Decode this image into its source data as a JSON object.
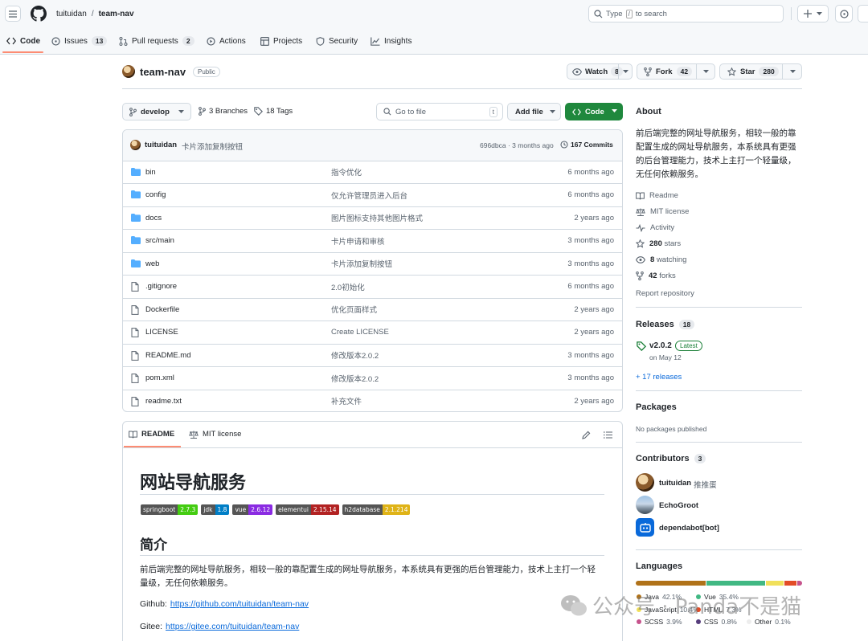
{
  "header": {
    "owner": "tuituidan",
    "sep": "/",
    "repo": "team-nav",
    "search_placeholder_pre": "Type",
    "search_key": "/",
    "search_placeholder_post": "to search"
  },
  "tabs": [
    {
      "label": "Code",
      "count": ""
    },
    {
      "label": "Issues",
      "count": "13"
    },
    {
      "label": "Pull requests",
      "count": "2"
    },
    {
      "label": "Actions",
      "count": ""
    },
    {
      "label": "Projects",
      "count": ""
    },
    {
      "label": "Security",
      "count": ""
    },
    {
      "label": "Insights",
      "count": ""
    }
  ],
  "repo": {
    "name": "team-nav",
    "visibility": "Public",
    "watch_label": "Watch",
    "watch_count": "8",
    "fork_label": "Fork",
    "fork_count": "42",
    "star_label": "Star",
    "star_count": "280"
  },
  "toolbar": {
    "branch": "develop",
    "branches": "3 Branches",
    "tags": "18 Tags",
    "goto_placeholder": "Go to file",
    "goto_key": "t",
    "add_file": "Add file",
    "code": "Code"
  },
  "commit": {
    "author": "tuituidan",
    "message": "卡片添加复制按钮",
    "hash_time": "696dbca · 3 months ago",
    "commits": "167 Commits"
  },
  "files": [
    {
      "type": "dir",
      "name": "bin",
      "msg": "指令优化",
      "time": "6 months ago"
    },
    {
      "type": "dir",
      "name": "config",
      "msg": "仅允许管理员进入后台",
      "time": "6 months ago"
    },
    {
      "type": "dir",
      "name": "docs",
      "msg": "图片图标支持其他图片格式",
      "time": "2 years ago"
    },
    {
      "type": "dir",
      "name": "src/main",
      "msg": "卡片申请和审核",
      "time": "3 months ago"
    },
    {
      "type": "dir",
      "name": "web",
      "msg": "卡片添加复制按钮",
      "time": "3 months ago"
    },
    {
      "type": "file",
      "name": ".gitignore",
      "msg": "2.0初始化",
      "time": "6 months ago"
    },
    {
      "type": "file",
      "name": "Dockerfile",
      "msg": "优化页面样式",
      "time": "2 years ago"
    },
    {
      "type": "file",
      "name": "LICENSE",
      "msg": "Create LICENSE",
      "time": "2 years ago"
    },
    {
      "type": "file",
      "name": "README.md",
      "msg": "修改版本2.0.2",
      "time": "3 months ago"
    },
    {
      "type": "file",
      "name": "pom.xml",
      "msg": "修改版本2.0.2",
      "time": "3 months ago"
    },
    {
      "type": "file",
      "name": "readme.txt",
      "msg": "补充文件",
      "time": "2 years ago"
    }
  ],
  "readme": {
    "tab_readme": "README",
    "tab_license": "MIT license",
    "title": "网站导航服务",
    "badges": [
      {
        "l": "springboot",
        "r": "2.7.3",
        "color": "#4c1"
      },
      {
        "l": "jdk",
        "r": "1.8",
        "color": "#007ec6"
      },
      {
        "l": "vue",
        "r": "2.6.12",
        "color": "#8a2be2"
      },
      {
        "l": "elementui",
        "r": "2.15.14",
        "color": "#b22222"
      },
      {
        "l": "h2database",
        "r": "2.1.214",
        "color": "#dfb317"
      }
    ],
    "intro_heading": "简介",
    "intro_text": "前后端完整的网址导航服务，相较一般的靠配置生成的网址导航服务，本系统具有更强的后台管理能力，技术上主打一个轻量级，无任何依赖服务。",
    "github_label": "Github:",
    "github_url": "https://github.com/tuituidan/team-nav",
    "gitee_label": "Gitee:",
    "gitee_url": "https://gitee.com/tuituidan/team-nav"
  },
  "about": {
    "heading": "About",
    "description": "前后端完整的网址导航服务，相较一般的靠配置生成的网址导航服务，本系统具有更强的后台管理能力，技术上主打一个轻量级，无任何依赖服务。",
    "readme": "Readme",
    "license": "MIT license",
    "activity": "Activity",
    "stars_n": "280",
    "stars_t": "stars",
    "watching_n": "8",
    "watching_t": "watching",
    "forks_n": "42",
    "forks_t": "forks",
    "report": "Report repository"
  },
  "releases": {
    "heading": "Releases",
    "count": "18",
    "version": "v2.0.2",
    "latest": "Latest",
    "date": "on May 12",
    "more": "+ 17 releases"
  },
  "packages": {
    "heading": "Packages",
    "none": "No packages published"
  },
  "contributors": {
    "heading": "Contributors",
    "count": "3",
    "items": [
      {
        "login": "tuituidan",
        "name": "推推蛋"
      },
      {
        "login": "EchoGroot",
        "name": ""
      },
      {
        "login": "dependabot[bot]",
        "name": ""
      }
    ]
  },
  "languages": {
    "heading": "Languages",
    "items": [
      {
        "name": "Java",
        "pct": "42.1%",
        "value": 42.1,
        "color": "#b07219"
      },
      {
        "name": "Vue",
        "pct": "35.4%",
        "value": 35.4,
        "color": "#41b883"
      },
      {
        "name": "JavaScript",
        "pct": "10.4%",
        "value": 10.4,
        "color": "#f1e05a"
      },
      {
        "name": "HTML",
        "pct": "7.3%",
        "value": 7.3,
        "color": "#e34c26"
      },
      {
        "name": "SCSS",
        "pct": "3.9%",
        "value": 3.9,
        "color": "#c6538c"
      },
      {
        "name": "CSS",
        "pct": "0.8%",
        "value": 0.8,
        "color": "#563d7c"
      },
      {
        "name": "Other",
        "pct": "0.1%",
        "value": 0.1,
        "color": "#ededed"
      }
    ]
  },
  "watermark": "公众号 · Panda不是猫"
}
